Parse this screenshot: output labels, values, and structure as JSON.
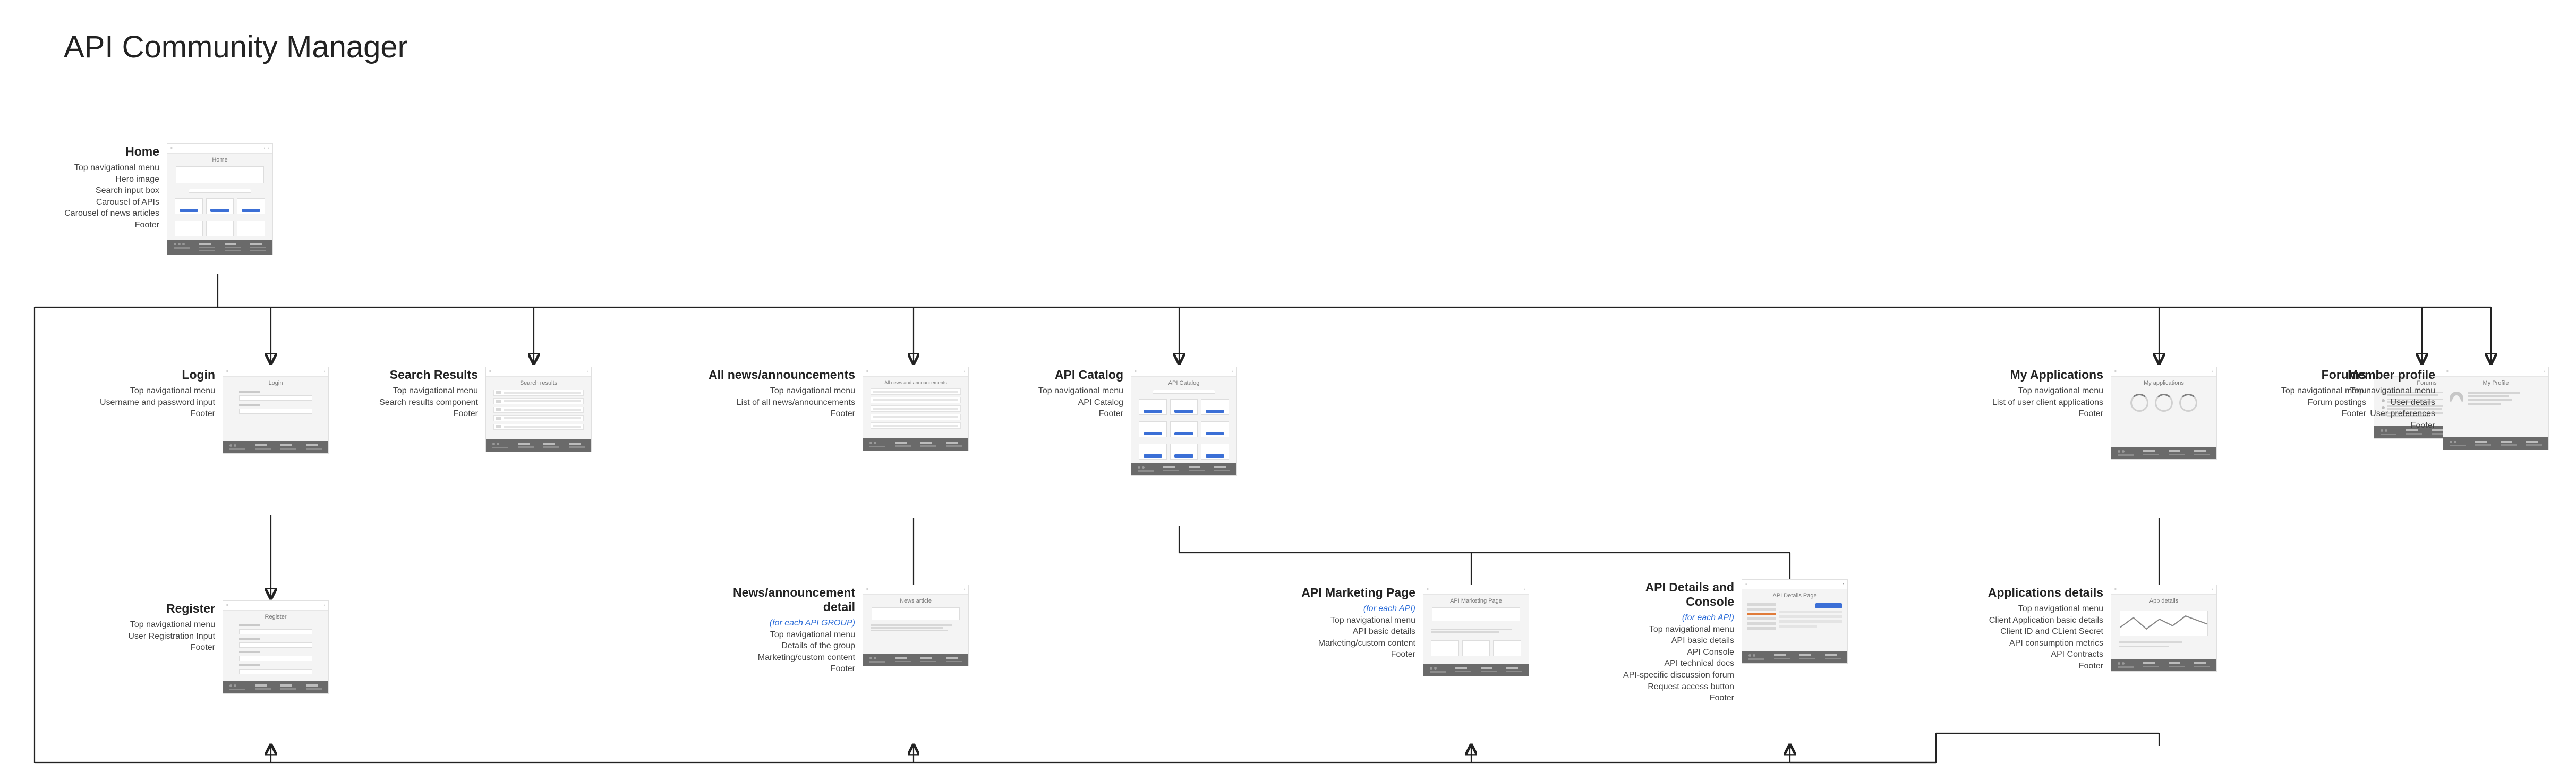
{
  "title": "API Community Manager",
  "nodes": {
    "home": {
      "heading": "Home",
      "items": [
        "Top navigational menu",
        "Hero image",
        "Search input box",
        "Carousel of APIs",
        "Carousel of news articles",
        "Footer"
      ],
      "wf_title": "Home"
    },
    "login": {
      "heading": "Login",
      "items": [
        "Top navigational menu",
        "Username and password input",
        "Footer"
      ],
      "wf_title": "Login"
    },
    "search": {
      "heading": "Search Results",
      "items": [
        "Top navigational menu",
        "Search results component",
        "Footer"
      ],
      "wf_title": "Search results"
    },
    "allnews": {
      "heading": "All news/announcements",
      "items": [
        "Top navigational menu",
        "List of all news/announcements",
        "Footer"
      ],
      "wf_title": "All news and announcements"
    },
    "catalog": {
      "heading": "API Catalog",
      "items": [
        "Top navigational menu",
        "API Catalog",
        "Footer"
      ],
      "wf_title": "API Catalog"
    },
    "myapps": {
      "heading": "My Applications",
      "items": [
        "Top navigational menu",
        "List of user client applications",
        "Footer"
      ],
      "wf_title": "My applications"
    },
    "forums": {
      "heading": "Forums",
      "items": [
        "Top navigational menu",
        "Forum postings",
        "Footer"
      ],
      "wf_title": "Forums"
    },
    "profile": {
      "heading": "Member profile",
      "items": [
        "Top navigational menu",
        "User details",
        "User preferences",
        "Footer"
      ],
      "wf_title": "My Profile"
    },
    "register": {
      "heading": "Register",
      "items": [
        "Top navigational menu",
        "User Registration Input",
        "Footer"
      ],
      "wf_title": "Register"
    },
    "newsdetail": {
      "heading": "News/announcement detail",
      "note": "(for each API GROUP)",
      "items": [
        "Top navigational menu",
        "Details of the group",
        "Marketing/custom content",
        "Footer"
      ],
      "wf_title": "News article"
    },
    "marketing": {
      "heading": "API Marketing Page",
      "note": "(for each API)",
      "items": [
        "Top navigational menu",
        "API basic details",
        "Marketing/custom content",
        "Footer"
      ],
      "wf_title": "API Marketing Page"
    },
    "details": {
      "heading": "API Details and Console",
      "note": "(for each API)",
      "items": [
        "Top navigational menu",
        "API basic details",
        "API Console",
        "API technical docs",
        "API-specific discussion forum",
        "Request access button",
        "Footer"
      ],
      "wf_title": "API Details Page"
    },
    "appdetails": {
      "heading": "Applications details",
      "items": [
        "Top navigational menu",
        "Client Application basic details",
        "Client ID and CLient Secret",
        "API consumption metrics",
        "API Contracts",
        "Footer"
      ],
      "wf_title": "App details"
    }
  }
}
